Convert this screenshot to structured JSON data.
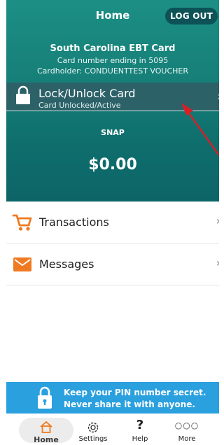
{
  "header": {
    "title": "Home",
    "logout_label": "LOG OUT"
  },
  "card": {
    "name": "South Carolina EBT Card",
    "number_text": "Card number ending in 5095",
    "cardholder_text": "Cardholder: CONDUENTTEST VOUCHER"
  },
  "lock": {
    "title": "Lock/Unlock Card",
    "status": "Card Unlocked/Active",
    "chevron": "›"
  },
  "balance": {
    "label": "SNAP",
    "amount": "$0.00"
  },
  "list": [
    {
      "label": "Transactions",
      "icon": "cart-icon",
      "chevron": "›"
    },
    {
      "label": "Messages",
      "icon": "envelope-icon",
      "chevron": "›"
    }
  ],
  "banner": {
    "line1": "Keep your PIN number secret.",
    "line2": "Never share it with anyone."
  },
  "nav": [
    {
      "label": "Home",
      "icon": "home-icon",
      "active": true
    },
    {
      "label": "Settings",
      "icon": "gear-icon",
      "active": false
    },
    {
      "label": "Help",
      "icon": "question-icon",
      "active": false
    },
    {
      "label": "More",
      "icon": "more-icon",
      "active": false
    }
  ],
  "colors": {
    "teal": "#167f78",
    "lock_row": "#2d6168",
    "accent_orange": "#f07a22",
    "banner_blue": "#2aa0df",
    "arrow_red": "#d81f26"
  }
}
